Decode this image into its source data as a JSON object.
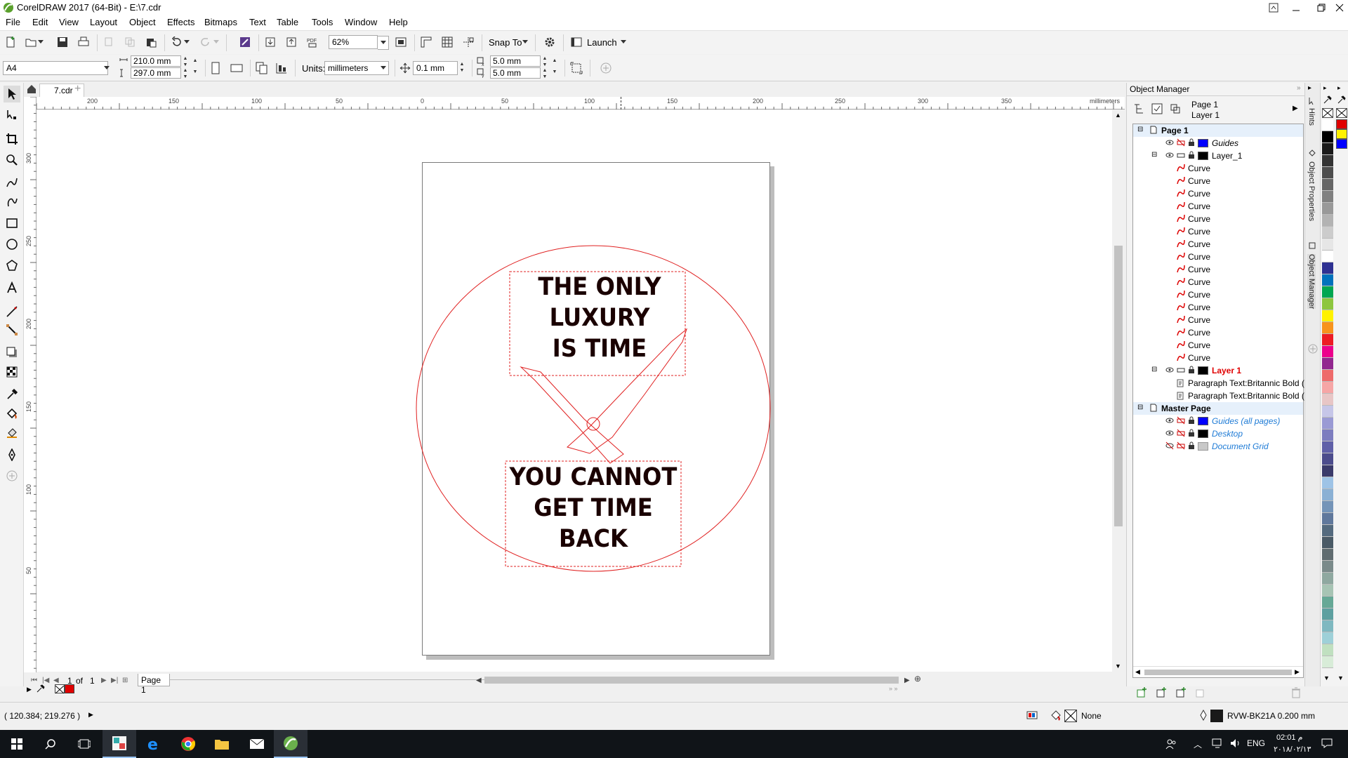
{
  "window": {
    "title": "CorelDRAW 2017 (64-Bit) - E:\\7.cdr"
  },
  "menu": [
    {
      "id": "file",
      "label": "File"
    },
    {
      "id": "edit",
      "label": "Edit"
    },
    {
      "id": "view",
      "label": "View"
    },
    {
      "id": "layout",
      "label": "Layout"
    },
    {
      "id": "object",
      "label": "Object"
    },
    {
      "id": "effects",
      "label": "Effects"
    },
    {
      "id": "bitmaps",
      "label": "Bitmaps"
    },
    {
      "id": "text",
      "label": "Text"
    },
    {
      "id": "table",
      "label": "Table"
    },
    {
      "id": "tools",
      "label": "Tools"
    },
    {
      "id": "window",
      "label": "Window"
    },
    {
      "id": "help",
      "label": "Help"
    }
  ],
  "toolbar": {
    "zoom": "62%",
    "snap_to": "Snap To",
    "launch": "Launch"
  },
  "propertybar": {
    "page_size": "A4",
    "width": "210.0 mm",
    "height": "297.0 mm",
    "units_label": "Units:",
    "units": "millimeters",
    "nudge": "0.1 mm",
    "dup_x": "5.0 mm",
    "dup_y": "5.0 mm"
  },
  "document": {
    "tab": "7.cdr"
  },
  "ruler": {
    "unit_label": "millimeters",
    "h_labels": [
      "200",
      "150",
      "100",
      "50",
      "0",
      "50",
      "100",
      "150",
      "200",
      "250",
      "300",
      "350"
    ],
    "v_labels": [
      "300",
      "250",
      "200",
      "150",
      "100",
      "50"
    ]
  },
  "artwork": {
    "top_text": [
      "THE ONLY",
      "LUXURY",
      "IS TIME"
    ],
    "bottom_text": [
      "YOU CANNOT",
      "GET TIME",
      "BACK"
    ],
    "line_color": "#e02020",
    "text_color": "#1a0000"
  },
  "page_nav": {
    "current": "1",
    "of_label": "of",
    "total": "1",
    "page_tab": "Page 1"
  },
  "object_manager": {
    "title": "Object Manager",
    "header_page": "Page 1",
    "header_layer": "Layer 1",
    "page1": "Page 1",
    "guides": "Guides",
    "layer_underscore": "Layer_1",
    "curves": [
      "Curve",
      "Curve",
      "Curve",
      "Curve",
      "Curve",
      "Curve",
      "Curve",
      "Curve",
      "Curve",
      "Curve",
      "Curve",
      "Curve",
      "Curve",
      "Curve",
      "Curve",
      "Curve"
    ],
    "layer1": "Layer 1",
    "para1": "Paragraph Text:Britannic Bold (",
    "para2": "Paragraph Text:Britannic Bold (",
    "master_page": "Master Page",
    "guides_all": "Guides (all pages)",
    "desktop": "Desktop",
    "document_grid": "Document Grid",
    "guides_color": "#0000ff",
    "layer_color": "#000000",
    "grid_color": "#c8c8c8"
  },
  "side_tabs": {
    "hints": "Hints",
    "object_properties": "Object Properties",
    "object_manager": "Object Manager"
  },
  "palette": [
    "#ffffff",
    "#000000",
    "#1a1a1a",
    "#333333",
    "#4d4d4d",
    "#666666",
    "#808080",
    "#999999",
    "#b3b3b3",
    "#cccccc",
    "#e6e6e6",
    "#ffffff",
    "#2e3192",
    "#0072bc",
    "#00a651",
    "#8dc63f",
    "#fff200",
    "#f7941d",
    "#ed1c24",
    "#ec008c",
    "#92278f",
    "#ee6b6b",
    "#f6a6a6",
    "#e8c6c6",
    "#c6c6e8",
    "#9a9ad4",
    "#7d7dbf",
    "#6060a8",
    "#4c4c8c",
    "#3a3a6a",
    "#9ec3e6",
    "#8ab0d4",
    "#7494b8",
    "#60789c",
    "#546a7e",
    "#4a5a66",
    "#606c70",
    "#7a8a8a",
    "#8fa8a0",
    "#a7c4b4",
    "#66a896",
    "#5ea0a0",
    "#7fb8c0",
    "#9ed0d8",
    "#c0e0c0",
    "#d8ecd8"
  ],
  "status": {
    "coords": "( 120.384; 219.276 )",
    "fill_none": "None",
    "outline": "RVW-BK21A  0.200 mm"
  },
  "taskbar": {
    "lang": "ENG",
    "time": "02:01 م",
    "date": "۲۰۱۸/۰۲/۱۳"
  }
}
